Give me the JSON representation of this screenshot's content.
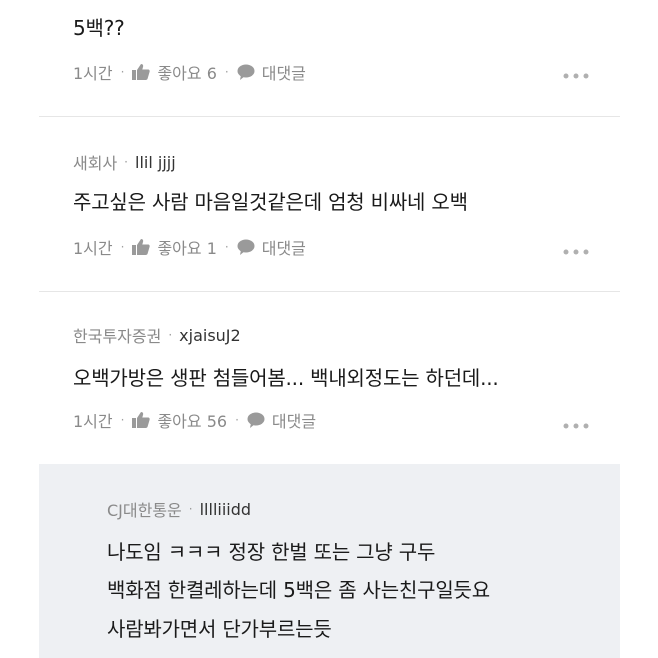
{
  "comments": [
    {
      "company": "",
      "nickname": "",
      "text": "5백??",
      "time": "1시간",
      "like_label": "좋아요 6",
      "reply_label": "대댓글"
    },
    {
      "company": "새회사",
      "nickname": "llil jjjj",
      "text": "주고싶은 사람 마음일것같은데 엄청 비싸네 오백",
      "time": "1시간",
      "like_label": "좋아요 1",
      "reply_label": "대댓글"
    },
    {
      "company": "한국투자증권",
      "nickname": "xjaisuJ2",
      "text": "오백가방은 생판 첨들어봄... 백내외정도는 하던데...",
      "time": "1시간",
      "like_label": "좋아요 56",
      "reply_label": "대댓글"
    }
  ],
  "reply": {
    "company": "CJ대한통운",
    "nickname": "lllliiidd",
    "lines": [
      "나도임 ㅋㅋㅋ 정장 한벌 또는 그냥 구두",
      "백화점 한켤레하는데 5백은 좀 사는친구일듯요",
      "사람봐가면서 단가부르는듯"
    ]
  },
  "separator": "·",
  "icons": {
    "like": "thumbs-up-icon",
    "reply": "speech-bubble-icon",
    "more": "more-dots-icon"
  },
  "colors": {
    "text": "#1a1a1a",
    "muted": "#8a8a8a",
    "reply_bg": "#eef0f3",
    "divider": "#e6e6e6"
  }
}
